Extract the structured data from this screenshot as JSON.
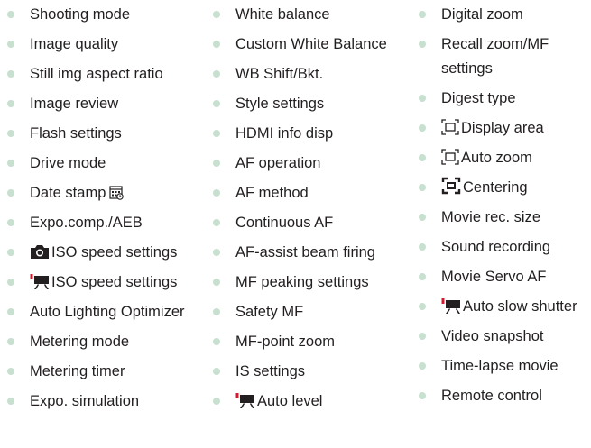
{
  "columns": [
    {
      "items": [
        {
          "label": "Shooting mode"
        },
        {
          "label": "Image quality"
        },
        {
          "label": "Still img aspect ratio"
        },
        {
          "label": "Image review"
        },
        {
          "label": "Flash settings"
        },
        {
          "label": "Drive mode"
        },
        {
          "label": "Date stamp",
          "icon": "date-stamp-icon"
        },
        {
          "label": "Expo.comp./AEB"
        },
        {
          "label": "ISO speed settings",
          "icon": "camera-icon"
        },
        {
          "label": "ISO speed settings",
          "icon": "movie-camera-icon"
        },
        {
          "label": "Auto Lighting Optimizer"
        },
        {
          "label": "Metering mode"
        },
        {
          "label": "Metering timer"
        },
        {
          "label": "Expo. simulation"
        }
      ]
    },
    {
      "items": [
        {
          "label": "White balance"
        },
        {
          "label": "Custom White Balance"
        },
        {
          "label": "WB Shift/Bkt."
        },
        {
          "label": "Style settings"
        },
        {
          "label": "HDMI info disp"
        },
        {
          "label": "AF operation"
        },
        {
          "label": "AF method"
        },
        {
          "label": "Continuous AF"
        },
        {
          "label": "AF-assist beam firing"
        },
        {
          "label": "MF peaking settings"
        },
        {
          "label": "Safety MF"
        },
        {
          "label": "MF-point zoom"
        },
        {
          "label": "IS settings"
        },
        {
          "label": "Auto level",
          "icon": "movie-camera-icon"
        }
      ]
    },
    {
      "items": [
        {
          "label": "Digital zoom"
        },
        {
          "label": "Recall zoom/MF settings"
        },
        {
          "label": "Digest type"
        },
        {
          "label": "Display area",
          "icon": "zoom-frame-icon"
        },
        {
          "label": "Auto zoom",
          "icon": "zoom-frame-icon"
        },
        {
          "label": "Centering",
          "icon": "centering-icon"
        },
        {
          "label": "Movie rec. size"
        },
        {
          "label": "Sound recording"
        },
        {
          "label": "Movie Servo AF"
        },
        {
          "label": "Auto slow shutter",
          "icon": "movie-camera-icon"
        },
        {
          "label": "Video snapshot"
        },
        {
          "label": "Time-lapse movie"
        },
        {
          "label": "Remote control"
        }
      ]
    }
  ],
  "colors": {
    "bullet": "#c7e0cf",
    "text": "#231f20",
    "icon": "#231f20",
    "movie_icon_accent": "#d7192f"
  }
}
